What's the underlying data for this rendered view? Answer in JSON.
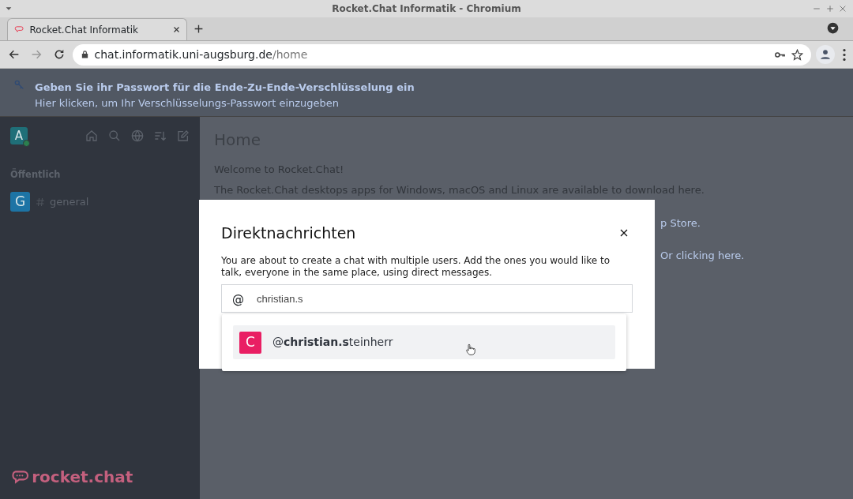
{
  "window": {
    "title": "Rocket.Chat Informatik - Chromium"
  },
  "tabs": [
    {
      "title": "Rocket.Chat Informatik",
      "selected": true
    }
  ],
  "address": {
    "host": "chat.informatik.uni-augsburg.de",
    "path": "/home"
  },
  "banner": {
    "title": "Geben Sie ihr Passwort für die Ende-Zu-Ende-Verschlüsselung ein",
    "link": "Hier klicken, um Ihr Verschlüsselungs-Passwort einzugeben"
  },
  "sidebar": {
    "user": {
      "initial": "A",
      "online": true
    },
    "section": "Öffentlich",
    "rooms": [
      {
        "initial": "G",
        "name": "general",
        "color": "#1d74a5"
      }
    ],
    "logo": "rocket.chat"
  },
  "main": {
    "title": "Home",
    "lines": [
      {
        "kind": "text",
        "text": "Welcome to Rocket.Chat!"
      },
      {
        "kind": "text",
        "text": "The Rocket.Chat desktops apps for Windows, macOS and Linux are available to download here."
      },
      {
        "kind": "fragment",
        "text": "p Store."
      },
      {
        "kind": "fragment",
        "text": "Or clicking here."
      }
    ]
  },
  "modal": {
    "title": "Direktnachrichten",
    "description": "You are about to create a chat with multiple users. Add the ones you would like to talk, everyone in the same place, using direct messages.",
    "search": {
      "prefix": "@",
      "value": "christian.s"
    },
    "suggestions": [
      {
        "initial": "C",
        "text": "@**christian.s**teinherr",
        "color": "#e91e63",
        "selected": true
      }
    ]
  }
}
